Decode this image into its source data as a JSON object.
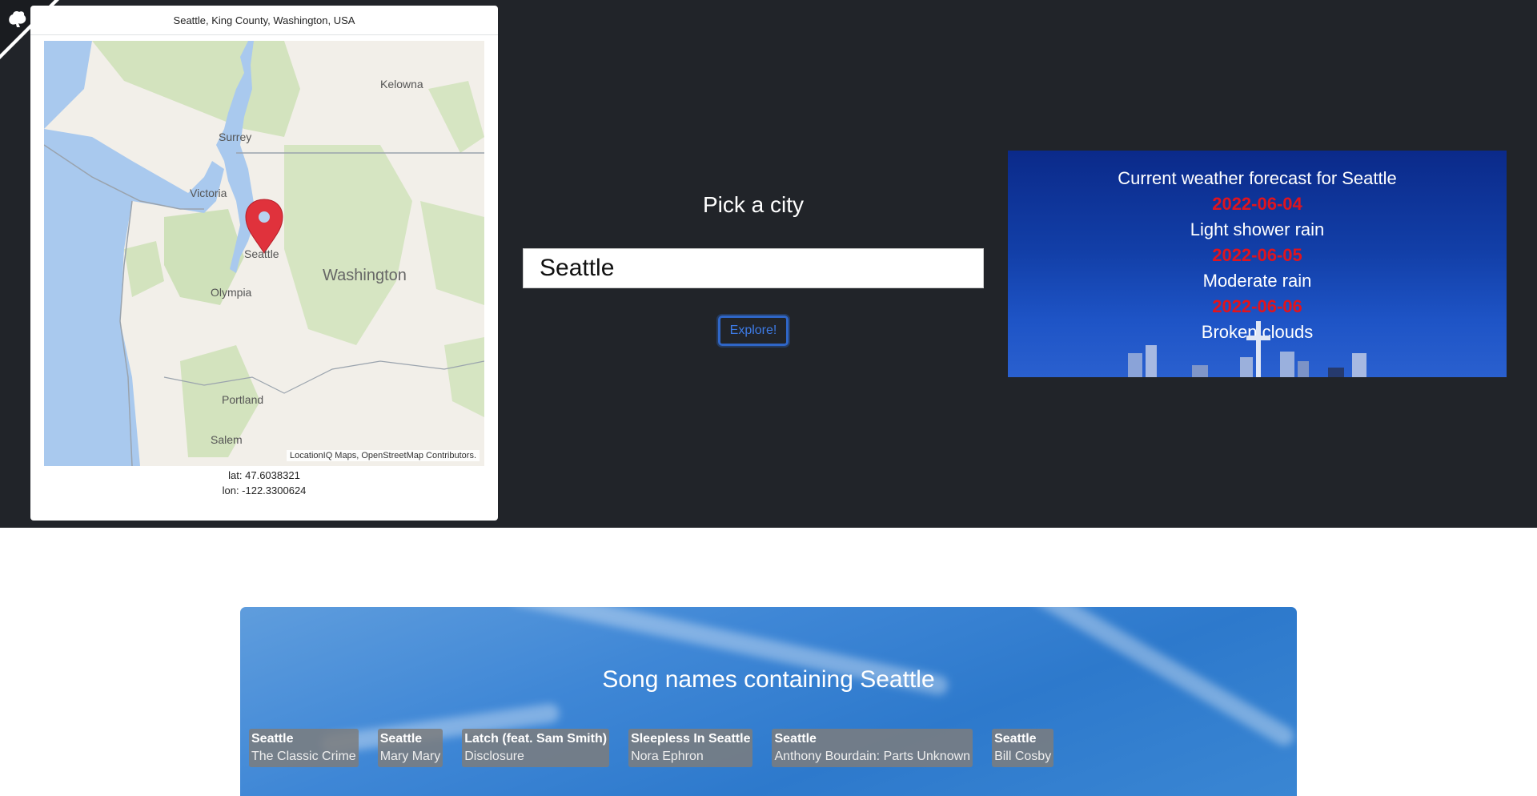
{
  "map": {
    "location_title": "Seattle, King County, Washington, USA",
    "labels": {
      "kelowna": "Kelowna",
      "surrey": "Surrey",
      "victoria": "Victoria",
      "seattle": "Seattle",
      "olympia": "Olympia",
      "washington": "Washington",
      "portland": "Portland",
      "salem": "Salem"
    },
    "attribution": "LocationIQ Maps, OpenStreetMap Contributors.",
    "lat": "lat: 47.6038321",
    "lon": "lon: -122.3300624",
    "pin_color": "#e0323c"
  },
  "search": {
    "title": "Pick a city",
    "value": "Seattle",
    "button_label": "Explore!"
  },
  "weather": {
    "title": "Current weather forecast for Seattle",
    "days": [
      {
        "date": "2022-06-04",
        "description": "Light shower rain"
      },
      {
        "date": "2022-06-05",
        "description": "Moderate rain"
      },
      {
        "date": "2022-06-06",
        "description": "Broken clouds"
      }
    ],
    "date_color": "#e0141e"
  },
  "songs": {
    "title": "Song names containing Seattle",
    "items": [
      {
        "name": "Seattle",
        "artist": "The Classic Crime"
      },
      {
        "name": "Seattle",
        "artist": "Mary Mary"
      },
      {
        "name": "Latch (feat. Sam Smith)",
        "artist": "Disclosure"
      },
      {
        "name": "Sleepless In Seattle",
        "artist": "Nora Ephron"
      },
      {
        "name": "Seattle",
        "artist": "Anthony Bourdain: Parts Unknown"
      },
      {
        "name": "Seattle",
        "artist": "Bill Cosby"
      }
    ]
  },
  "icons": {
    "corner": "github-octocat-icon",
    "pin": "map-pin-icon"
  }
}
